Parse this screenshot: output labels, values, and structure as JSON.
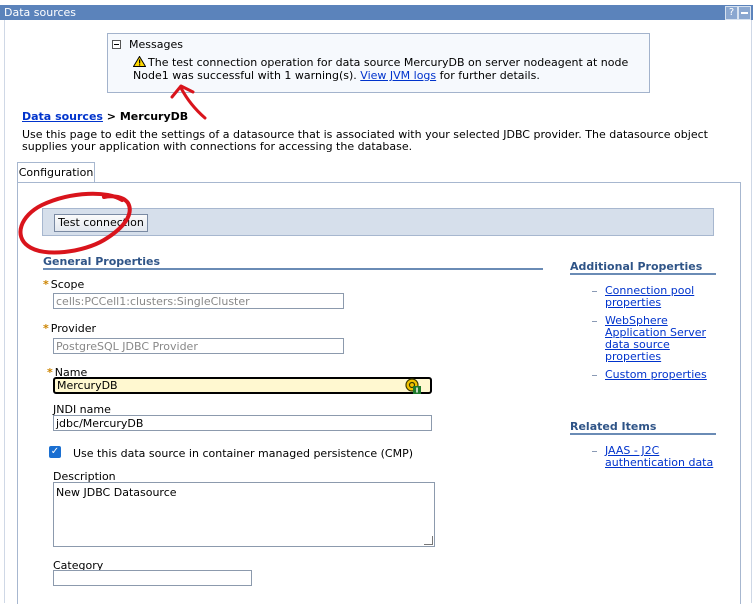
{
  "window": {
    "title": "Data sources",
    "help_label": "?"
  },
  "messages": {
    "header": "Messages",
    "text_before": "The test connection operation for data source MercuryDB on server nodeagent at node Node1 was successful with 1 warning(s).",
    "link_text": "View JVM logs",
    "text_after": "for further details."
  },
  "breadcrumb": {
    "link": "Data sources",
    "separator": ">",
    "current": "MercuryDB"
  },
  "intro": "Use this page to edit the settings of a datasource that is associated with your selected JDBC provider. The datasource object supplies your application with connections for accessing the database.",
  "tabs": [
    {
      "label": "Configuration"
    }
  ],
  "buttons": {
    "test_connection": "Test connection"
  },
  "general_properties": {
    "title": "General Properties",
    "scope": {
      "label": "Scope",
      "value": "cells:PCCell1:clusters:SingleCluster"
    },
    "provider": {
      "label": "Provider",
      "value": "PostgreSQL JDBC Provider"
    },
    "name": {
      "label": "Name",
      "value": "MercuryDB"
    },
    "jndi": {
      "label": "JNDI name",
      "value": "jdbc/MercuryDB"
    },
    "cmp": {
      "label": "Use this data source in container managed persistence (CMP)",
      "checked": true
    },
    "description": {
      "label": "Description",
      "value": "New JDBC Datasource"
    },
    "category": {
      "label": "Category",
      "value": ""
    }
  },
  "additional_properties": {
    "title": "Additional Properties",
    "links": [
      {
        "line1": "Connection pool",
        "line2": "properties"
      },
      {
        "line1": "WebSphere",
        "line2": "Application Server",
        "line3": "data source",
        "line4": "properties"
      },
      {
        "line1": "Custom properties"
      }
    ]
  },
  "related_items": {
    "title": "Related Items",
    "links": [
      {
        "line1": "JAAS - J2C",
        "line2": "authentication data"
      }
    ]
  },
  "colors": {
    "titlebar": "#5b83bb",
    "section": "#2f5487",
    "link": "#0033cc",
    "annotation": "#d9141c",
    "required": "#cc8400"
  }
}
